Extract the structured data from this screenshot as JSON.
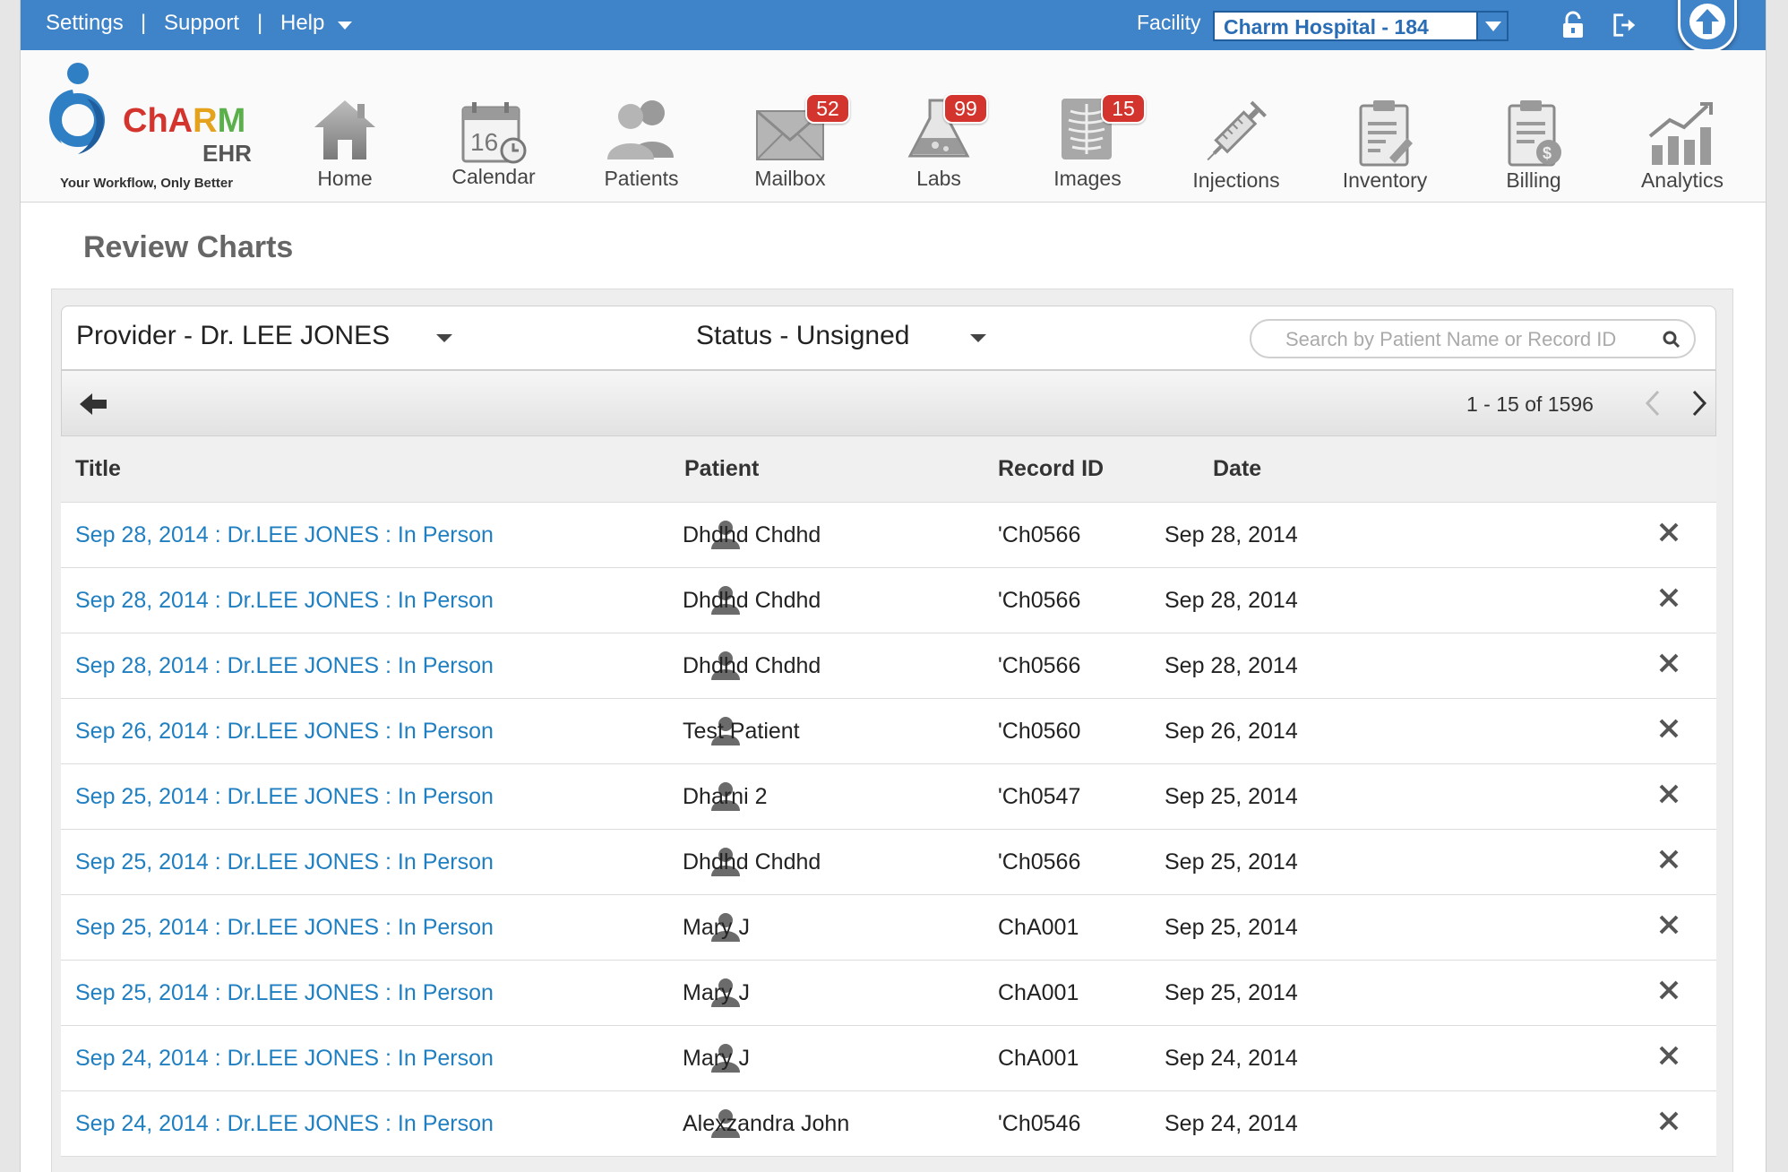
{
  "topbar": {
    "settings": "Settings",
    "support": "Support",
    "help": "Help",
    "sep1": "|",
    "sep2": "|",
    "facility_label": "Facility",
    "facility_value": "Charm Hospital - 184",
    "icons": [
      "unlock-icon",
      "logout-icon",
      "upload-arrow-icon"
    ]
  },
  "logo": {
    "brand": "ChARM",
    "sub": "EHR",
    "tagline": "Your Workflow, Only Better"
  },
  "nav": {
    "items": [
      {
        "label": "Home",
        "icon": "home-icon"
      },
      {
        "label": "Calendar",
        "icon": "calendar-icon",
        "date": "16"
      },
      {
        "label": "Patients",
        "icon": "patients-icon"
      },
      {
        "label": "Mailbox",
        "icon": "mailbox-icon",
        "badge": "52"
      },
      {
        "label": "Labs",
        "icon": "labs-flask-icon",
        "badge": "99"
      },
      {
        "label": "Images",
        "icon": "images-xray-icon",
        "badge": "15"
      },
      {
        "label": "Injections",
        "icon": "syringe-icon"
      },
      {
        "label": "Inventory",
        "icon": "inventory-clipboard-icon"
      },
      {
        "label": "Billing",
        "icon": "billing-clipboard-icon"
      },
      {
        "label": "Analytics",
        "icon": "analytics-chart-icon"
      }
    ]
  },
  "page": {
    "title": "Review Charts"
  },
  "filters": {
    "provider": "Provider -  Dr. LEE JONES",
    "status": "Status -  Unsigned",
    "search_placeholder": "Search by Patient Name or Record ID"
  },
  "pager": {
    "count": "1 - 15 of 1596"
  },
  "table": {
    "headers": {
      "title": "Title",
      "patient": "Patient",
      "record_id": "Record ID",
      "date": "Date"
    },
    "rows": [
      {
        "title": "Sep 28, 2014 : Dr.LEE JONES : In Person",
        "patient": "Dhdhd Chdhd",
        "record_id": "'Ch0566",
        "date": "Sep 28, 2014"
      },
      {
        "title": "Sep 28, 2014 : Dr.LEE JONES : In Person",
        "patient": "Dhdhd Chdhd",
        "record_id": "'Ch0566",
        "date": "Sep 28, 2014"
      },
      {
        "title": "Sep 28, 2014 : Dr.LEE JONES : In Person",
        "patient": "Dhdhd Chdhd",
        "record_id": "'Ch0566",
        "date": "Sep 28, 2014"
      },
      {
        "title": "Sep 26, 2014 : Dr.LEE JONES : In Person",
        "patient": "Test Patient",
        "record_id": "'Ch0560",
        "date": "Sep 26, 2014"
      },
      {
        "title": "Sep 25, 2014 : Dr.LEE JONES : In Person",
        "patient": "Dharni 2",
        "record_id": "'Ch0547",
        "date": "Sep 25, 2014"
      },
      {
        "title": "Sep 25, 2014 : Dr.LEE JONES : In Person",
        "patient": "Dhdhd Chdhd",
        "record_id": "'Ch0566",
        "date": "Sep 25, 2014"
      },
      {
        "title": "Sep 25, 2014 : Dr.LEE JONES : In Person",
        "patient": "Mary J",
        "record_id": "ChA001",
        "date": "Sep 25, 2014"
      },
      {
        "title": "Sep 25, 2014 : Dr.LEE JONES : In Person",
        "patient": "Mary J",
        "record_id": "ChA001",
        "date": "Sep 25, 2014"
      },
      {
        "title": "Sep 24, 2014 : Dr.LEE JONES : In Person",
        "patient": "Mary J",
        "record_id": "ChA001",
        "date": "Sep 24, 2014"
      },
      {
        "title": "Sep 24, 2014 : Dr.LEE JONES : In Person",
        "patient": "Alexzandra John",
        "record_id": "'Ch0546",
        "date": "Sep 24, 2014"
      }
    ]
  },
  "colors": {
    "topbar": "#3f83c8",
    "link": "#1f7fc1",
    "badge": "#d3352e"
  }
}
